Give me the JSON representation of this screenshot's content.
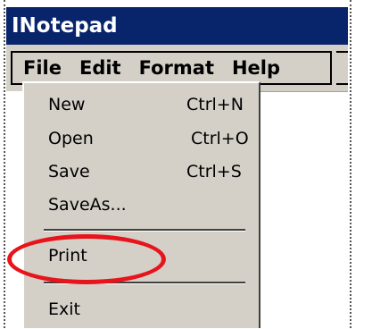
{
  "window": {
    "title": "INotepad"
  },
  "menubar": {
    "items": [
      "File",
      "Edit",
      "Format",
      "Help"
    ]
  },
  "file_menu": {
    "new": {
      "label": "New",
      "shortcut": "Ctrl+N"
    },
    "open": {
      "label": "Open",
      "shortcut": "Ctrl+O"
    },
    "save": {
      "label": "Save",
      "shortcut": "Ctrl+S"
    },
    "save_as": {
      "label": "SaveAs..."
    },
    "print": {
      "label": "Print"
    },
    "exit": {
      "label": "Exit"
    }
  },
  "colors": {
    "titlebar": "#08246b",
    "menu_background": "#d4d0c8",
    "highlight_oval": "#e8141b"
  }
}
